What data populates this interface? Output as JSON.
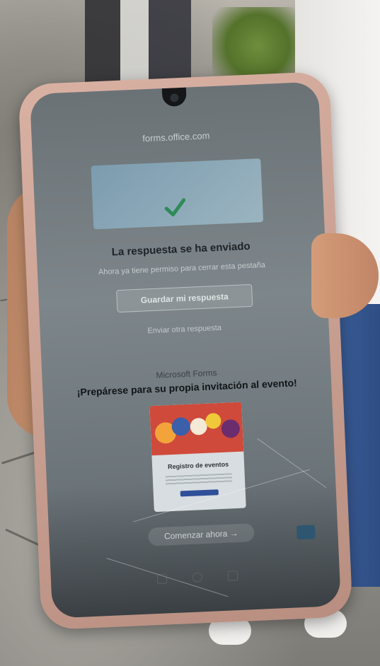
{
  "browser": {
    "url": "forms.office.com"
  },
  "confirmation": {
    "title": "La respuesta se ha enviado",
    "subtitle": "Ahora ya tiene permiso para cerrar esta pestaña",
    "save_button_label": "Guardar mi respuesta",
    "another_response_link": "Enviar otra respuesta"
  },
  "promo": {
    "brand": "Microsoft Forms",
    "heading": "¡Prepárese para su propia invitación al evento!",
    "card_title": "Registro de eventos",
    "start_button_label": "Comenzar ahora"
  },
  "colors": {
    "accent": "#2f4f9a",
    "check_green": "#2e8b57",
    "phone_case": "#d9b1a3"
  }
}
